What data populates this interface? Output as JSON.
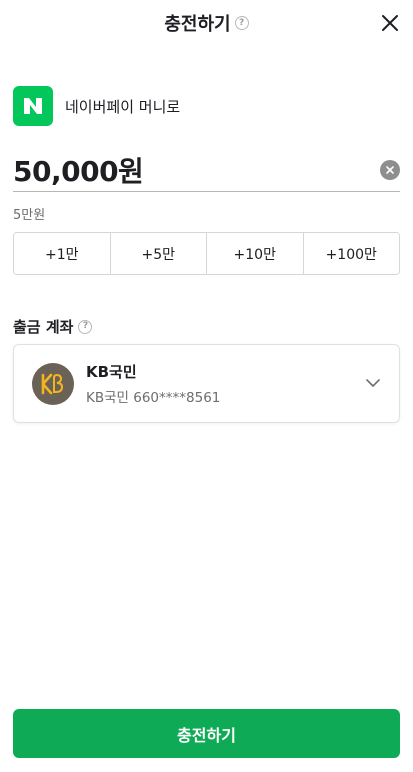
{
  "header": {
    "title": "충전하기",
    "help_icon": "question-circle-icon",
    "close_icon": "close-icon"
  },
  "source": {
    "logo_icon": "naver-n-logo",
    "logo_color": "#03c75a",
    "label": "네이버페이 머니로"
  },
  "amount": {
    "value": "50,000원",
    "hint": "5만원",
    "clear_icon": "clear-circle-icon"
  },
  "quick_buttons": [
    {
      "label": "+1만"
    },
    {
      "label": "+5만"
    },
    {
      "label": "+10만"
    },
    {
      "label": "+100만"
    }
  ],
  "withdraw_account": {
    "section_label": "출금 계좌",
    "help_icon": "question-circle-icon",
    "bank_logo_icon": "kb-bank-logo",
    "bank_name": "KB국민",
    "account_number": "KB국민 660****8561",
    "chevron_icon": "chevron-down-icon"
  },
  "cta": {
    "label": "충전하기",
    "color": "#0faa55"
  }
}
